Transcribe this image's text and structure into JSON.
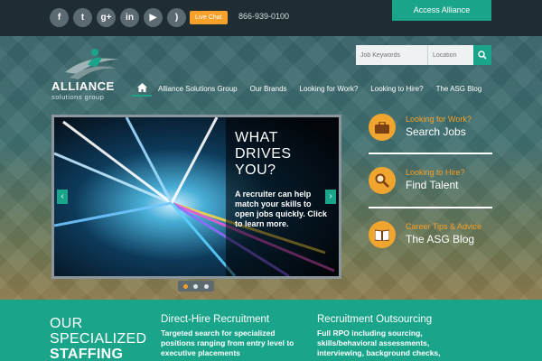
{
  "topbar": {
    "social": [
      {
        "icon": "facebook-icon",
        "glyph": "f"
      },
      {
        "icon": "twitter-icon",
        "glyph": "t"
      },
      {
        "icon": "google-plus-icon",
        "glyph": "g+"
      },
      {
        "icon": "linkedin-icon",
        "glyph": "in"
      },
      {
        "icon": "youtube-icon",
        "glyph": "▶"
      },
      {
        "icon": "rss-icon",
        "glyph": ")"
      }
    ],
    "live_chat": "Live Chat",
    "phone": "866-939-0100",
    "access_label": "Access Alliance"
  },
  "logo": {
    "word": "ALLIANCE",
    "sub": "solutions group"
  },
  "search": {
    "keyword_placeholder": "Job Keywords",
    "location_placeholder": "Location"
  },
  "nav": {
    "items": [
      "Alliance Solutions Group",
      "Our Brands",
      "Looking for Work?",
      "Looking to Hire?",
      "The ASG Blog"
    ]
  },
  "slider": {
    "heading": "WHAT DRIVES YOU?",
    "body": "A recruiter can help match your skills to open jobs quickly. Click to learn more."
  },
  "side": [
    {
      "kicker": "Looking for Work?",
      "title": "Search Jobs",
      "icon": "briefcase-icon"
    },
    {
      "kicker": "Looking to Hire?",
      "title": "Find Talent",
      "icon": "magnifier-icon"
    },
    {
      "kicker": "Career Tips & Advice",
      "title": "The ASG Blog",
      "icon": "book-icon"
    }
  ],
  "band": {
    "heading_line1": "OUR",
    "heading_line2": "SPECIALIZED",
    "heading_line3": "STAFFING",
    "columns": [
      {
        "title": "Direct-Hire Recruitment",
        "body": "Targeted search for specialized positions ranging from entry level to executive placements"
      },
      {
        "title": "Recruitment Outsourcing",
        "body": "Full RPO including sourcing, skills/behavioral assessments, interviewing, background checks,"
      }
    ]
  },
  "colors": {
    "accent": "#1aa58b",
    "orange": "#f7a12a",
    "topbar": "#1f2d33"
  }
}
